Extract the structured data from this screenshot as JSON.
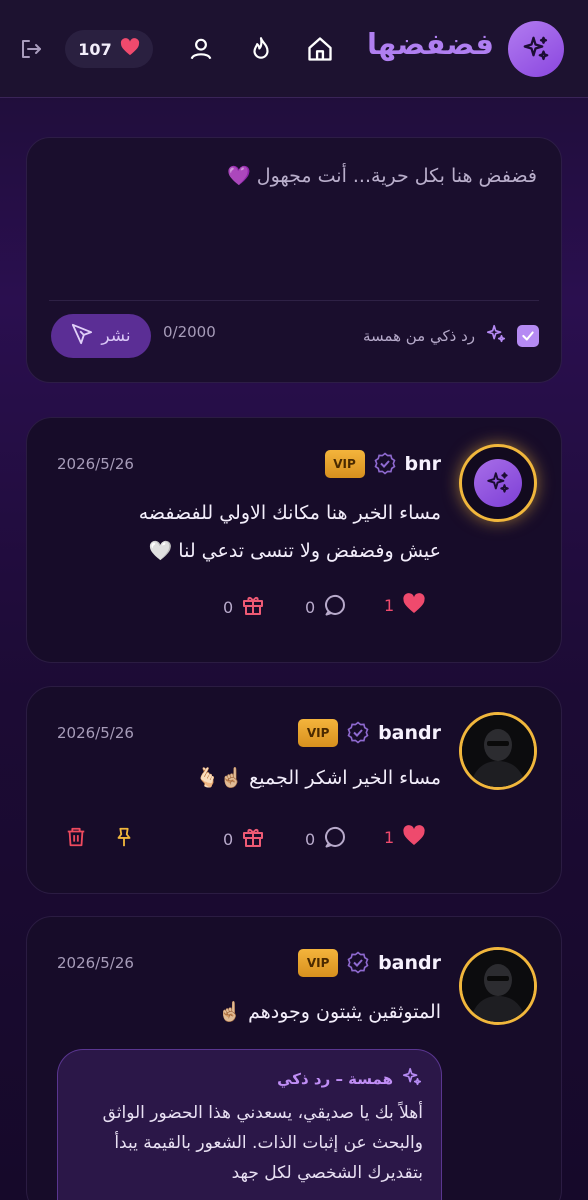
{
  "header": {
    "app_title": "فضفضها",
    "hearts_count": "107",
    "icons": [
      "sparkles-icon",
      "home-icon",
      "flame-icon",
      "user-icon",
      "heart-icon",
      "logout-icon"
    ]
  },
  "composer": {
    "placeholder": "فضفض هنا بكل حرية... أنت مجهول 💜",
    "char_count": "0/2000",
    "smart_reply_label": "رد ذكي من همسة",
    "smart_reply_checked": true,
    "publish_label": "نشر"
  },
  "posts": [
    {
      "username": "bnr",
      "badge": "VIP",
      "date": "2026/5/26",
      "text_line1": "مساء الخير هنا مكانك الاولي للفضفضه",
      "text_line2": "عيش وفضفض ولا تنسى تدعي لنا 🤍",
      "likes": "1",
      "comments": "0",
      "gifts": "0"
    },
    {
      "username": "bandr",
      "badge": "VIP",
      "date": "2026/5/26",
      "text_line1": "مساء الخير  اشكر الجميع ☝🏼🫰🏻",
      "likes": "1",
      "comments": "0",
      "gifts": "0"
    },
    {
      "username": "bandr",
      "badge": "VIP",
      "date": "2026/5/26",
      "text_line1": "المتوثقين يثبتون وجودهم ☝🏼",
      "ai_reply_title": "همسة – رد ذكي",
      "ai_reply_text": "أهلاً بك يا صديقي، يسعدني هذا الحضور الواثق والبحث عن إثبات الذات. الشعور بالقيمة يبدأ بتقديرك الشخصي لكل جهد"
    }
  ],
  "colors": {
    "accent": "#b07ff1",
    "gold": "#f1b73c",
    "like_red": "#ef4a6d",
    "gift_red": "#ee5a74"
  }
}
